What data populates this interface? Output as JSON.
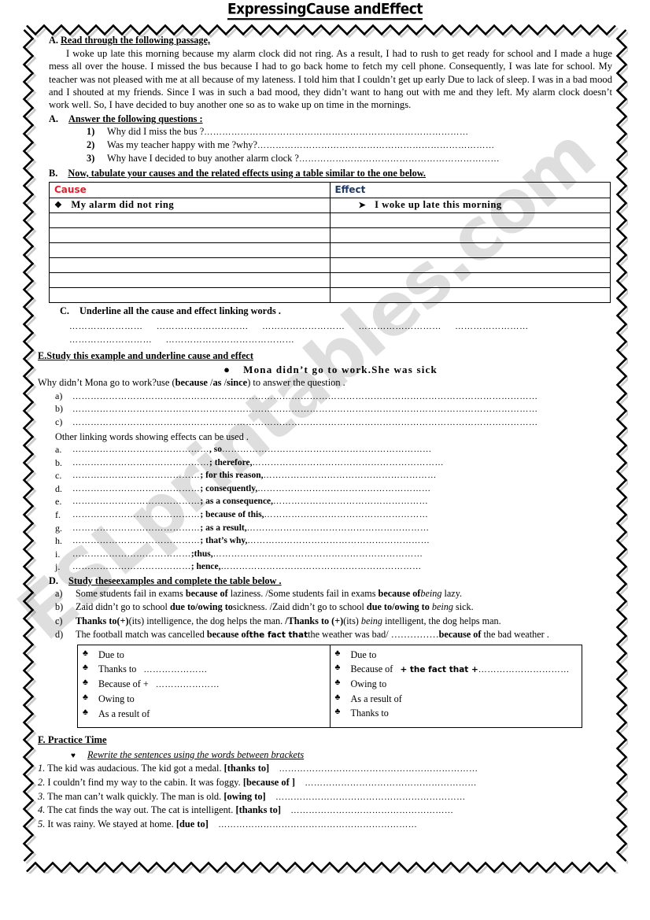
{
  "title": "ExpressingCause andEffect",
  "watermark": "ESLprintables.com",
  "sections": {
    "a_read": {
      "label": "A.",
      "heading": "Read through the following passage,",
      "passage": "I woke up late this morning because my alarm clock did not ring. As a result, I had to rush to get ready for school and I made a huge mess all over the house. I missed the bus because I had to go back home to fetch my cell phone. Consequently, I was late for school. My teacher was not pleased with me at all because of my lateness. I told him that I couldn’t get up early Due to lack of sleep. I was in a bad mood and I shouted at my friends. Since I was in such a bad mood, they didn’t want to hang out with me and they left. My alarm clock doesn’t work well. So, I have decided to buy another one so as to wake up on time in the mornings."
    },
    "a_questions": {
      "label": "A.",
      "heading": "Answer the following questions :",
      "items": [
        {
          "num": "1)",
          "text": "Why did I miss the bus ?",
          "dots": "……………………………………………………………………………"
        },
        {
          "num": "2)",
          "text": "Was my teacher happy with me ?why?",
          "dots": "……………………………………………………………………"
        },
        {
          "num": "3)",
          "text": "Why have I decided to buy another alarm clock ?",
          "dots": "…………………………………………………………"
        }
      ]
    },
    "b_table": {
      "label": "B.",
      "heading": "Now, tabulate your causes and the related effects using a table similar to the one below.",
      "header_cause": "Cause",
      "header_effect": "Effect",
      "cause_color": "#e3202b",
      "effect_color": "#1f3864",
      "cause_bullet": "❖",
      "effect_bullet": "➤",
      "first_cause": "My alarm did not ring",
      "first_effect": "I woke up late this morning",
      "empty_rows": 6
    },
    "c_underline": {
      "label": "C.",
      "heading": "Underline all the cause and effect linking words .",
      "dot_rows": [
        [
          "……………………",
          "…………………………",
          "………………………",
          "………………………",
          "……………………"
        ],
        [
          "………………………",
          "……………………………………"
        ]
      ]
    },
    "e_study": {
      "label": "E.",
      "heading": "Study this example and underline cause and effect",
      "example": "Mona didn’t go to work.She was sick",
      "question_pre": "Why didn’t Mona go to work?use (",
      "question_bold1": "because",
      "question_sep1": " /",
      "question_bold2": "as",
      "question_sep2": " /",
      "question_bold3": "since",
      "question_post": ") to answer the question  .",
      "blank_items": [
        {
          "num": "a)",
          "dots": "………………………………………………………………………………………………………………………………………"
        },
        {
          "num": "b)",
          "dots": "………………………………………………………………………………………………………………………………………"
        },
        {
          "num": "c)",
          "dots": "………………………………………………………………………………………………………………………………………"
        }
      ],
      "other_note": "Other linking words showing effects can be used .",
      "linkers": [
        {
          "num": "a.",
          "left": "………………………………………",
          "word": ", so",
          "right": "……………………………………………………………"
        },
        {
          "num": "b.",
          "left": "………………………………………",
          "word": "; therefore,",
          "right": "………………………………………………………"
        },
        {
          "num": "c.",
          "left": "……………………………………",
          "word": "; for this reason,",
          "right": "…………………………………………………"
        },
        {
          "num": "d.",
          "left": "……………………………………",
          "word": "; consequently,",
          "right": "…………………………………………………"
        },
        {
          "num": "e.",
          "left": "……………………………………",
          "word": "; as a consequence,",
          "right": "……………………………………………"
        },
        {
          "num": "f.",
          "left": "……………………………………",
          "word": "; because of this,",
          "right": "………………………………………………"
        },
        {
          "num": "g.",
          "left": "……………………………………",
          "word": "; as a result,",
          "right": "……………………………………………………"
        },
        {
          "num": "h.",
          "left": "……………………………………",
          "word": "; that’s why,",
          "right": "……………………………………………………"
        },
        {
          "num": "i.",
          "left": "…………………………………",
          "word": ";thus,",
          "right": "……………………………………………………………"
        },
        {
          "num": "j.",
          "left": "…………………………………",
          "word": "; hence,",
          "right": "…………………………………………………………"
        }
      ]
    },
    "d_examples": {
      "label": "D.",
      "heading": "Study theseexamples and complete the table below .",
      "items": [
        {
          "num": "a)",
          "html": "Some students fail in exams <b>because of</b> laziness. /Some students fail in exams <b>because of</b><i>being</i> lazy."
        },
        {
          "num": "b)",
          "html": "Zaid didn’t go to school <b>due to/owing to</b>sickness. /Zaid didn’t go to school <b>due to/owing to</b> <i>being</i> sick."
        },
        {
          "num": "c)",
          "html": "<b>Thanks to(+)</b>(its) intelligence, the dog helps the man. <b>/Thanks to (+)</b>(its) <i>being</i> intelligent, the dog helps man."
        },
        {
          "num": "d)",
          "html": "The football match was cancelled <b>because of</b><span class=\"fact-bold\">the fact that</span>the weather was bad/ ……………<b>because of</b> the bad weather ."
        }
      ],
      "table_bullet": "♣",
      "left_column": [
        {
          "text": "Due to",
          "dots": ""
        },
        {
          "text": "Thanks to",
          "dots": "…………………"
        },
        {
          "text": "Because of   +",
          "dots": "…………………"
        },
        {
          "text": "Owing to",
          "dots": ""
        },
        {
          "text": "As a result of",
          "dots": ""
        }
      ],
      "right_column": [
        {
          "text": "Due to",
          "mid": "",
          "dots": ""
        },
        {
          "text": "Because of",
          "mid": "+ the fact that +",
          "dots": "…………………………"
        },
        {
          "text": "Owing to",
          "mid": "",
          "dots": ""
        },
        {
          "text": "As a result of",
          "mid": "",
          "dots": ""
        },
        {
          "text": "Thanks to",
          "mid": "",
          "dots": ""
        }
      ]
    },
    "f_practice": {
      "label": "F.",
      "heading": "Practice Time",
      "bullet": "♥",
      "instruction": "Rewrite the sentences using the words between brackets",
      "items": [
        {
          "num": "1.",
          "text": "The kid was audacious.  The kid got a medal.",
          "bracket": "[thanks to]",
          "dots": "…………………………………………………………"
        },
        {
          "num": "2.",
          "text": "I couldn’t find my way to the cabin.  It was foggy.",
          "bracket": "[because of ]",
          "dots": "…………………………………………………"
        },
        {
          "num": "3.",
          "text": "The man can’t walk quickly.  The man is old.",
          "bracket": "[owing to]",
          "dots": "………………………………………………………"
        },
        {
          "num": "4.",
          "text": "The cat finds the way out.  The cat is intelligent.",
          "bracket": "[thanks to]",
          "dots": "………………………………………………"
        },
        {
          "num": "5.",
          "text": "It was rainy.  We stayed at home.",
          "bracket": "[due to]",
          "dots": "…………………………………………………………"
        }
      ]
    }
  }
}
